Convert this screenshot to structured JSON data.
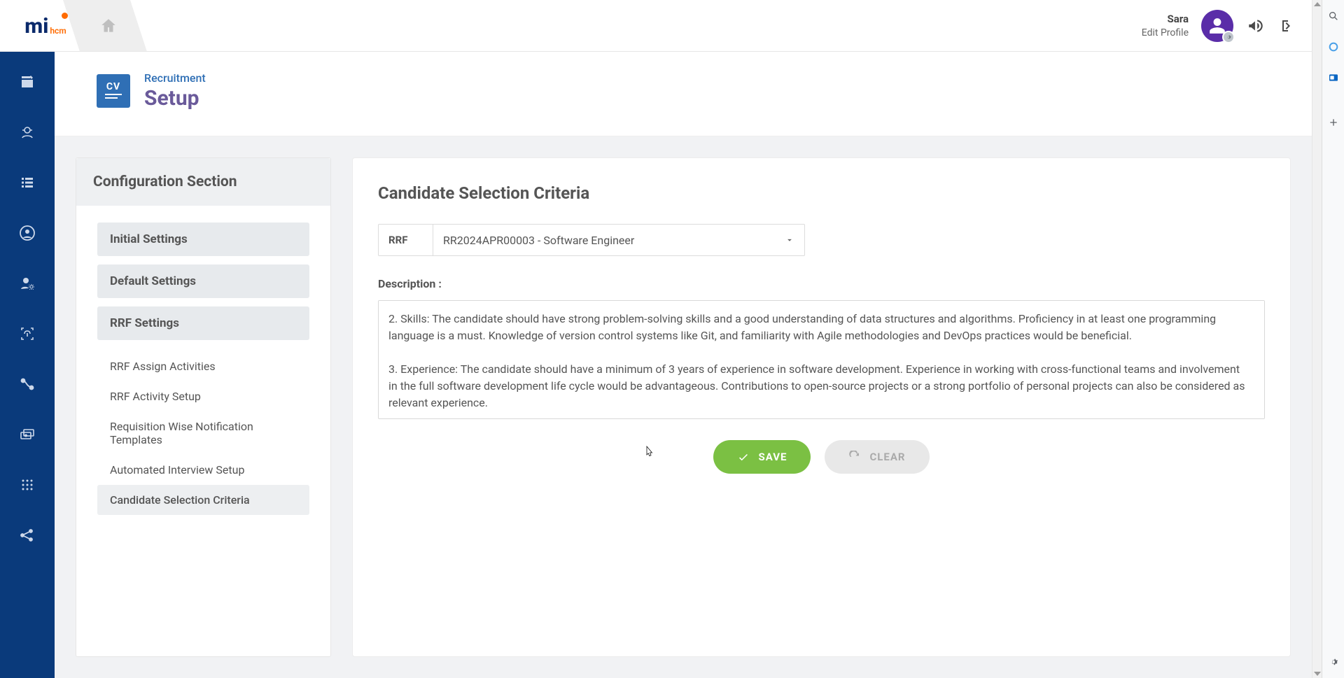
{
  "header": {
    "user_name": "Sara",
    "edit_profile": "Edit Profile"
  },
  "page": {
    "breadcrumb": "Recruitment",
    "title": "Setup",
    "icon_text": "CV"
  },
  "config": {
    "heading": "Configuration Section",
    "tabs": {
      "initial": "Initial Settings",
      "default": "Default Settings",
      "rrf": "RRF Settings"
    },
    "rrf_subs": [
      "RRF Assign Activities",
      "RRF Activity Setup",
      "Requisition Wise Notification Templates",
      "Automated Interview Setup",
      "Candidate Selection Criteria"
    ],
    "active_sub_index": 4
  },
  "form": {
    "title": "Candidate Selection Criteria",
    "rrf_label": "RRF",
    "rrf_value": "RR2024APR00003 - Software Engineer",
    "desc_label": "Description :",
    "description": "2. Skills: The candidate should have strong problem-solving skills and a good understanding of data structures and algorithms. Proficiency in at least one programming language is a must. Knowledge of version control systems like Git, and familiarity with Agile methodologies and DevOps practices would be beneficial.\n\n3. Experience: The candidate should have a minimum of 3 years of experience in software development. Experience in working with cross-functional teams and involvement in the full software development life cycle would be advantageous. Contributions to open-source projects or a strong portfolio of personal projects can also be considered as relevant experience.",
    "save_label": "SAVE",
    "clear_label": "CLEAR"
  },
  "colors": {
    "sidebar": "#0a3a7b",
    "accent_green": "#7bc043",
    "accent_purple": "#6a5a9a",
    "link_blue": "#2f6fb5"
  }
}
